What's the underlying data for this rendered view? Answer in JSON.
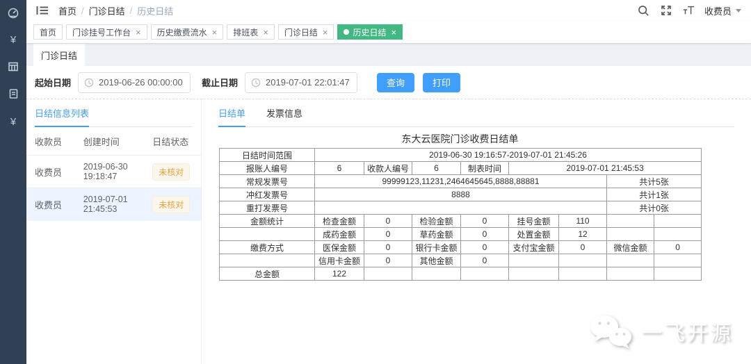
{
  "colors": {
    "accent_blue": "#409eff",
    "active_tag_green": "#42b983",
    "warning_orange": "#e6a23c",
    "sidebar_bg": "#304156",
    "selected_row_bg": "#ecf5ff"
  },
  "sidebar": {
    "yuan_glyph": "¥"
  },
  "navbar": {
    "breadcrumb": {
      "items": [
        "首页",
        "门诊日结",
        "历史日结"
      ],
      "separator": "/"
    },
    "user_menu": {
      "label": "收费员"
    }
  },
  "tags_view": {
    "tags": [
      {
        "label": "首页",
        "closable": false,
        "active": false
      },
      {
        "label": "门诊挂号工作台",
        "closable": true,
        "active": false
      },
      {
        "label": "历史缴费流水",
        "closable": true,
        "active": false
      },
      {
        "label": "排班表",
        "closable": true,
        "active": false
      },
      {
        "label": "门诊日结",
        "closable": true,
        "active": false
      },
      {
        "label": "历史日结",
        "closable": true,
        "active": true
      }
    ]
  },
  "page_tab": {
    "label": "门诊日结"
  },
  "filter": {
    "start_date": {
      "label": "起始日期",
      "value": "2019-06-26 00:00:00"
    },
    "end_date": {
      "label": "截止日期",
      "value": "2019-07-01 22:01:47"
    },
    "query_button": "查询",
    "print_button": "打印"
  },
  "list_panel": {
    "tab_label": "日结信息列表",
    "columns": [
      "收款员",
      "创建时间",
      "日结状态"
    ],
    "rows": [
      {
        "cashier": "收费员",
        "created": "2019-06-30 19:18:47",
        "status": "未核对",
        "selected": false
      },
      {
        "cashier": "收费员",
        "created": "2019-07-01 21:45:53",
        "status": "未核对",
        "selected": true
      }
    ]
  },
  "detail_panel": {
    "tabs": [
      {
        "label": "日结单",
        "active": true
      },
      {
        "label": "发票信息",
        "active": false
      }
    ],
    "report": {
      "title": "东大云医院门诊收费日结单",
      "rows": [
        [
          {
            "t": "日结时间范围"
          },
          {
            "t": "2019-06-30 19:16:57-2019-07-01 21:45:26",
            "cs": 8
          }
        ],
        [
          {
            "t": "报账人编号"
          },
          {
            "t": "6"
          },
          {
            "t": "收款人编号"
          },
          {
            "t": "6"
          },
          {
            "t": "制表时间"
          },
          {
            "t": "2019-07-01 21:45:53",
            "cs": 4
          }
        ],
        [
          {
            "t": "常规发票号"
          },
          {
            "t": "99999123,11231,2464645645,8888,88881",
            "cs": 6
          },
          {
            "t": "共计5张",
            "cs": 2
          }
        ],
        [
          {
            "t": "冲红发票号"
          },
          {
            "t": "8888",
            "cs": 6
          },
          {
            "t": "共计1张",
            "cs": 2
          }
        ],
        [
          {
            "t": "重打发票号"
          },
          {
            "t": "",
            "cs": 6
          },
          {
            "t": "共计0张",
            "cs": 2
          }
        ],
        [
          {
            "t": "金额统计"
          },
          {
            "t": "检查金额"
          },
          {
            "t": "0"
          },
          {
            "t": "检验金额"
          },
          {
            "t": "0"
          },
          {
            "t": "挂号金额"
          },
          {
            "t": "110"
          },
          {
            "t": ""
          },
          {
            "t": ""
          }
        ],
        [
          {
            "t": ""
          },
          {
            "t": "成药金额"
          },
          {
            "t": "0"
          },
          {
            "t": "草药金额"
          },
          {
            "t": "0"
          },
          {
            "t": "处置金额"
          },
          {
            "t": "12"
          },
          {
            "t": ""
          },
          {
            "t": ""
          }
        ],
        [
          {
            "t": "缴费方式"
          },
          {
            "t": "医保金额"
          },
          {
            "t": "0"
          },
          {
            "t": "银行卡金额"
          },
          {
            "t": "0"
          },
          {
            "t": "支付宝金额"
          },
          {
            "t": "0"
          },
          {
            "t": "微信金额"
          },
          {
            "t": "0"
          }
        ],
        [
          {
            "t": ""
          },
          {
            "t": "信用卡金额"
          },
          {
            "t": "0"
          },
          {
            "t": "其他金额"
          },
          {
            "t": "0"
          },
          {
            "t": ""
          },
          {
            "t": ""
          },
          {
            "t": ""
          },
          {
            "t": ""
          }
        ],
        [
          {
            "t": "总金额"
          },
          {
            "t": "122"
          },
          {
            "t": ""
          },
          {
            "t": ""
          },
          {
            "t": ""
          },
          {
            "t": ""
          },
          {
            "t": ""
          },
          {
            "t": ""
          },
          {
            "t": ""
          }
        ]
      ]
    }
  },
  "watermark": {
    "text": "一飞开源"
  }
}
